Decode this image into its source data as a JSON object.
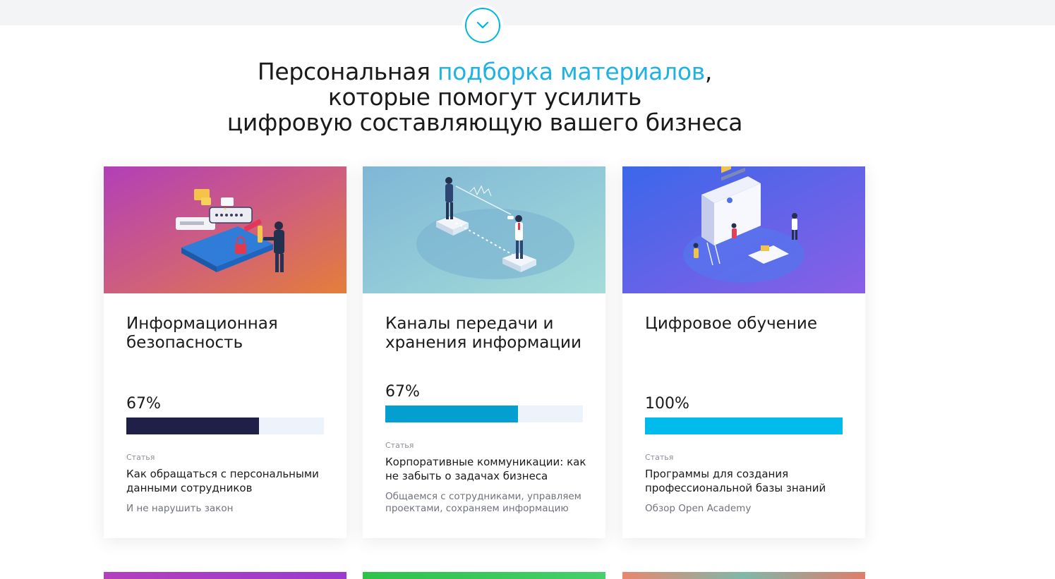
{
  "headline": {
    "line1_pre": "Персональная ",
    "line1_accent": "подборка материалов",
    "line1_post": ",",
    "line2": "которые помогут усилить",
    "line3": "цифровую составляющую вашего бизнеса"
  },
  "scroll_button": {
    "icon": "chevron-down-icon"
  },
  "colors": {
    "accent": "#1fb2e2",
    "bar_dark": "#1f1f47",
    "bar_blue": "#039fd1",
    "bar_cyan": "#00bbec",
    "bar_track": "#edf3fa"
  },
  "cards": [
    {
      "title": "Информационная безопасность",
      "progress_label": "67%",
      "progress": 0.67,
      "kind": "Статья",
      "article_title": "Как обращаться с персональными данными сотрудников",
      "subtitle": "И не нарушить закон",
      "illustration": "security-illustration"
    },
    {
      "title": "Каналы передачи и хранения информации",
      "progress_label": "67%",
      "progress": 0.67,
      "kind": "Статья",
      "article_title": "Корпоративные коммуникации: как не забыть о задачах бизнеса",
      "subtitle": "Общаемся с сотрудниками, управляем проектами, сохраняем информацию",
      "illustration": "communication-illustration"
    },
    {
      "title": "Цифровое обучение",
      "progress_label": "100%",
      "progress": 1.0,
      "kind": "Статья",
      "article_title": "Программы для создания профессиональной базы знаний",
      "subtitle": "Обзор Open Academy",
      "illustration": "learning-illustration"
    }
  ]
}
